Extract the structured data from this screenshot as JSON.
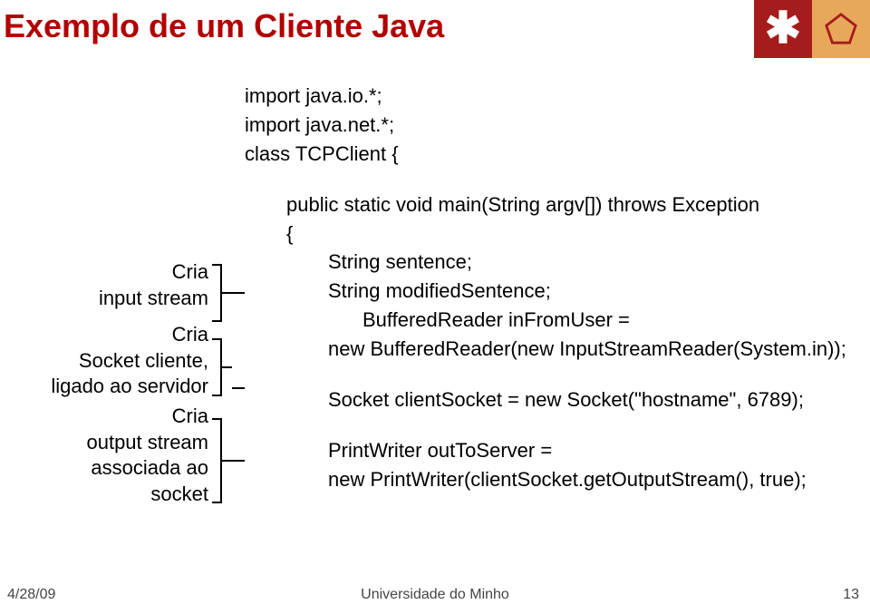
{
  "title": "Exemplo de um Cliente Java",
  "code": {
    "l1": "import java.io.*;",
    "l2": "import java.net.*;",
    "l3": "class TCPClient {",
    "l4": "public static void main(String argv[]) throws Exception",
    "l5": "{",
    "l6": "String sentence;",
    "l7": "String modifiedSentence;",
    "l8": "BufferedReader inFromUser =",
    "l9": "new BufferedReader(new InputStreamReader(System.in));",
    "l10": "Socket clientSocket = new Socket(\"hostname\", 6789);",
    "l11": "PrintWriter outToServer =",
    "l12": "new PrintWriter(clientSocket.getOutputStream(), true);"
  },
  "annotations": {
    "a1_l1": "Cria",
    "a1_l2": "input stream",
    "a2_l1": "Cria",
    "a2_l2": "Socket cliente,",
    "a2_l3": "ligado ao servidor",
    "a3_l1": "Cria",
    "a3_l2": "output stream",
    "a3_l3": "associada ao",
    "a3_l4": "socket"
  },
  "footer": {
    "date": "4/28/09",
    "center": "Universidade do Minho",
    "page": "13"
  }
}
